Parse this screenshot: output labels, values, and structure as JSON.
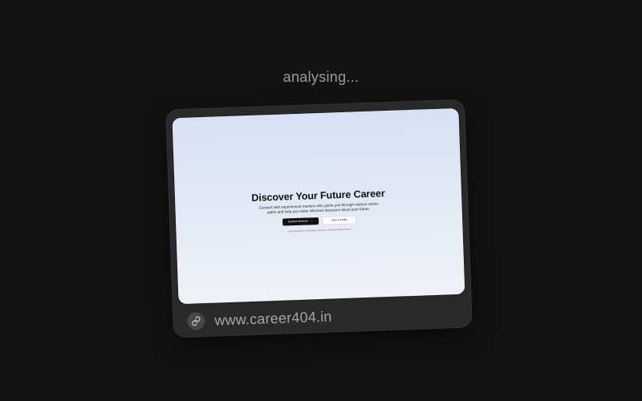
{
  "loader": {
    "status": "analysing..."
  },
  "preview": {
    "title": "Discover Your Future Career",
    "subtitle": "Connect with experienced mentors who guide you through various career paths and help you make informed decisions about your future.",
    "primary_button": "Explore Mentors",
    "primary_button_arrow": "→",
    "secondary_button": "How it works",
    "note": "Join thousands of students already connected with mentors"
  },
  "url_bar": {
    "icon": "link-icon",
    "url": "www.career404.in"
  },
  "colors": {
    "page_background": "#131313",
    "card_background": "#292929",
    "preview_gradient_top": "#d8e1f4",
    "preview_gradient_bottom": "#eef1f7"
  }
}
